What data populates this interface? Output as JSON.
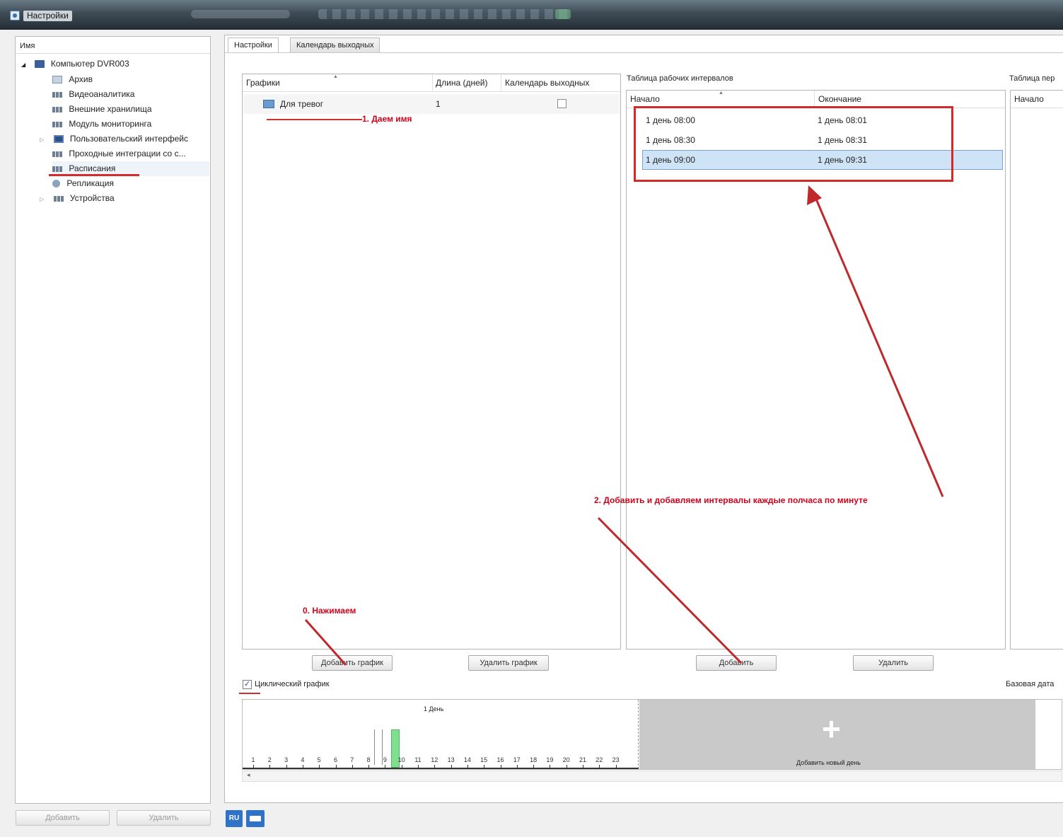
{
  "window": {
    "title": "Настройки"
  },
  "left_panel": {
    "header": "Имя",
    "root": {
      "label": "Компьютер DVR003",
      "expander": "◢"
    },
    "items": [
      {
        "label": "Архив"
      },
      {
        "label": "Видеоаналитика"
      },
      {
        "label": "Внешние хранилища"
      },
      {
        "label": "Модуль мониторинга"
      },
      {
        "label": "Пользовательский интерфейс",
        "expander": "▷"
      },
      {
        "label": "Проходные интеграции со с..."
      },
      {
        "label": "Расписания",
        "selected": true
      },
      {
        "label": "Репликация"
      },
      {
        "label": "Устройства",
        "expander": "▷"
      }
    ],
    "add_button": "Добавить",
    "delete_button": "Удалить"
  },
  "tabs": [
    {
      "label": "Настройки",
      "active": true
    },
    {
      "label": "Календарь выходных",
      "active": false
    }
  ],
  "schedules_table": {
    "columns": [
      "Графики",
      "Длина (дней)",
      "Календарь выходных"
    ],
    "rows": [
      {
        "name": "Для тревог",
        "length": "1",
        "holiday_calendar": false
      }
    ],
    "add_button": "Добавить график",
    "delete_button": "Удалить график"
  },
  "intervals_table": {
    "title": "Таблица рабочих интервалов",
    "columns": [
      "Начало",
      "Окончание"
    ],
    "rows": [
      {
        "start": "1 день 08:00",
        "end": "1 день 08:01"
      },
      {
        "start": "1 день 08:30",
        "end": "1 день 08:31"
      },
      {
        "start": "1 день 09:00",
        "end": "1 день 09:31",
        "selected": true
      }
    ],
    "add_button": "Добавить",
    "delete_button": "Удалить"
  },
  "third_table": {
    "title": "Таблица пер",
    "columns": [
      "Начало"
    ]
  },
  "cyclic": {
    "label": "Циклический график",
    "checked": true
  },
  "base_date_label": "Базовая дата",
  "timeline": {
    "day_label": "1 День",
    "hours": [
      "1",
      "2",
      "3",
      "4",
      "5",
      "6",
      "7",
      "8",
      "9",
      "10",
      "11",
      "12",
      "13",
      "14",
      "15",
      "16",
      "17",
      "18",
      "19",
      "20",
      "21",
      "22",
      "23"
    ],
    "active_hour": "9",
    "add_day_icon": "+",
    "add_day_label": "Добавить новый день",
    "scroll_arrow": "◂"
  },
  "annotations": {
    "step0": "0. Нажимаем",
    "step1": "1. Даем имя",
    "step2": "2. Добавить и добавляем интервалы каждые полчаса по минуте"
  },
  "bottom": {
    "lang_badge": "RU"
  },
  "colors": {
    "annotation_red": "#d0021b",
    "active_hour_green": "#7ee08e",
    "selection_blue": "#cfe3f7"
  }
}
